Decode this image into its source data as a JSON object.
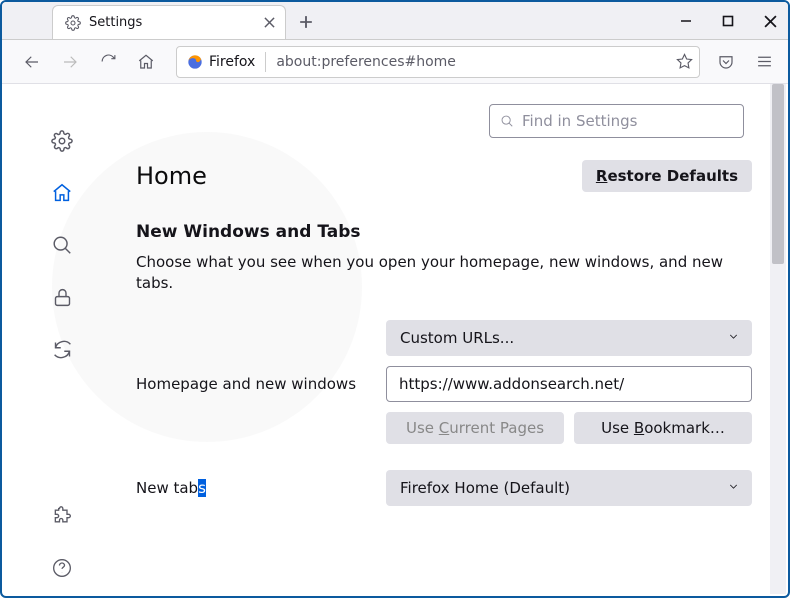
{
  "window": {
    "tab_title": "Settings",
    "url_label": "Firefox",
    "url_text": "about:preferences#home"
  },
  "search": {
    "placeholder": "Find in Settings"
  },
  "page": {
    "title": "Home",
    "restore_label": "Restore Defaults",
    "restore_keyletter": "R"
  },
  "section": {
    "heading": "New Windows and Tabs",
    "description": "Choose what you see when you open your homepage, new windows, and new tabs."
  },
  "homepage": {
    "label": "Homepage and new windows",
    "select_value": "Custom URLs...",
    "url_value": "https://www.addonsearch.net/",
    "use_current_label": "Use Current Pages",
    "use_current_keyletter": "C",
    "use_bookmark_label": "Use Bookmark…",
    "use_bookmark_keyletter": "B"
  },
  "newtabs": {
    "label": "New tabs",
    "label_prefix": "New tab",
    "label_sel": "s",
    "select_value": "Firefox Home (Default)"
  }
}
